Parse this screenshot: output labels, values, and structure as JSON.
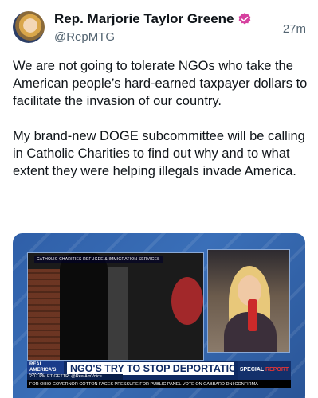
{
  "tweet": {
    "author_name": "Rep. Marjorie Taylor Greene",
    "handle": "@RepMTG",
    "timestamp": "27m",
    "verified": true,
    "verified_color": "#d6409f",
    "paragraph_1": "We are not going to tolerate NGOs who take the American people’s hard-earned taxpayer dollars to facilitate the invasion of our country.",
    "paragraph_2": "My brand-new DOGE subcommittee will be calling in Catholic Charities to find out why and to what extent they were helping illegals invade America."
  },
  "media": {
    "left_video_label": "CATHOLIC CHARITIES REFUGEE & IMMIGRATION SERVICES",
    "brand": "REAL AMERICA'S VOICE",
    "live_time": "2:17 PM ET",
    "headline": "NGO'S TRY TO STOP DEPORTATIONS",
    "social": "GETTR: @RealAmVoice",
    "special_label": "SPECIAL",
    "special_suffix": "REPORT",
    "ticker": "FOR OHIO GOVERNOR     COTTON FACES PRESSURE FOR PUBLIC PANEL VOTE ON GABBARD DNI CONFIRMA"
  }
}
